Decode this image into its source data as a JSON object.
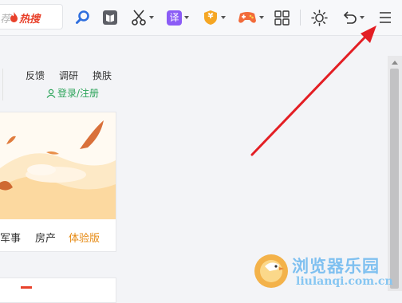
{
  "toolbar": {
    "search_hint": "荐",
    "hot_label": "热搜",
    "translate_label": "译",
    "wallet_label": "¥"
  },
  "page": {
    "ops_links": [
      "反馈",
      "调研",
      "换肤"
    ],
    "login_label": "登录/注册",
    "news_tabs": [
      "军事",
      "房产",
      "体验版"
    ]
  },
  "watermark": {
    "title": "浏览器乐园",
    "url": "liulanqi.com.cn"
  },
  "colors": {
    "hot_red": "#e8412b",
    "login_green": "#2ca45a",
    "highlight_orange": "#e68a13",
    "arrow_red": "#e31e24",
    "translate_purple": "#8b5cf6"
  }
}
